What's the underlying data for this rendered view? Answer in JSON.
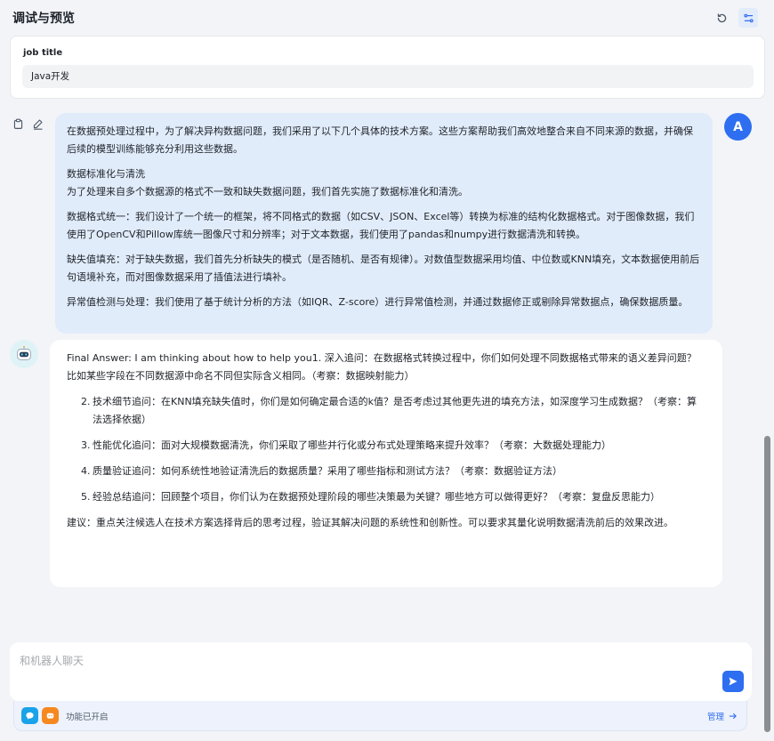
{
  "header": {
    "title": "调试与预览",
    "accent": "#2e6ef0"
  },
  "variables": {
    "label": "job title",
    "value": "Java开发"
  },
  "user_message": {
    "avatar_letter": "A",
    "paragraphs": [
      "在数据预处理过程中，为了解决异构数据问题，我们采用了以下几个具体的技术方案。这些方案帮助我们高效地整合来自不同来源的数据，并确保后续的模型训练能够充分利用这些数据。",
      "数据标准化与清洗",
      "为了处理来自多个数据源的格式不一致和缺失数据问题，我们首先实施了数据标准化和清洗。",
      "数据格式统一：我们设计了一个统一的框架，将不同格式的数据（如CSV、JSON、Excel等）转换为标准的结构化数据格式。对于图像数据，我们使用了OpenCV和Pillow库统一图像尺寸和分辨率；对于文本数据，我们使用了pandas和numpy进行数据清洗和转换。",
      "缺失值填充：对于缺失数据，我们首先分析缺失的模式（是否随机、是否有规律）。对数值型数据采用均值、中位数或KNN填充，文本数据使用前后句语境补充，而对图像数据采用了插值法进行填补。",
      "异常值检测与处理：我们使用了基于统计分析的方法（如IQR、Z-score）进行异常值检测，并通过数据修正或剔除异常数据点，确保数据质量。"
    ]
  },
  "bot_message": {
    "intro": "Final Answer: I am thinking about how to help you1. 深入追问：在数据格式转换过程中，你们如何处理不同数据格式带来的语义差异问题？比如某些字段在不同数据源中命名不同但实际含义相同。（考察：数据映射能力）",
    "items": [
      {
        "num": "2.",
        "text": "技术细节追问：在KNN填充缺失值时，你们是如何确定最合适的k值？是否考虑过其他更先进的填充方法，如深度学习生成数据？（考察：算法选择依据）"
      },
      {
        "num": "3.",
        "text": "性能优化追问：面对大规模数据清洗，你们采取了哪些并行化或分布式处理策略来提升效率？（考察：大数据处理能力）"
      },
      {
        "num": "4.",
        "text": "质量验证追问：如何系统性地验证清洗后的数据质量？采用了哪些指标和测试方法？（考察：数据验证方法）"
      },
      {
        "num": "5.",
        "text": "经验总结追问：回顾整个项目，你们认为在数据预处理阶段的哪些决策最为关键？哪些地方可以做得更好？（考察：复盘反思能力）"
      }
    ],
    "suggestion": "建议：重点关注候选人在技术方案选择背后的思考过程，验证其解决问题的系统性和创新性。可以要求其量化说明数据清洗前后的效果改进。"
  },
  "composer": {
    "placeholder": "和机器人聊天",
    "feature_status": "功能已开启",
    "manage_label": "管理"
  },
  "icons": {
    "refresh": "refresh-icon",
    "settings": "variable-settings-icon",
    "copy": "clipboard-icon",
    "edit": "pencil-icon",
    "send": "send-icon",
    "feature1": "chat-bubble-icon",
    "feature2": "bot-face-icon",
    "arrow": "arrow-right-icon"
  }
}
